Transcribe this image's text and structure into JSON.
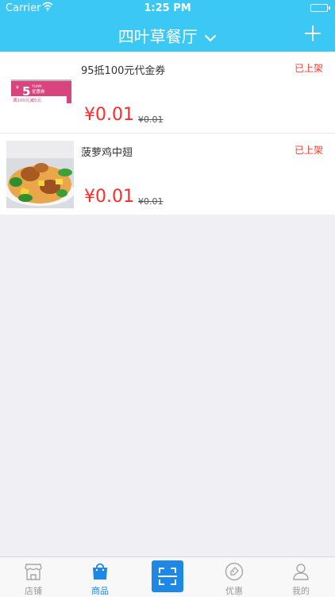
{
  "status_bar": {
    "carrier": "Carrier",
    "time": "1:25 PM"
  },
  "nav": {
    "title": "四叶草餐厅"
  },
  "products": [
    {
      "name": "95抵100元代金券",
      "status": "已上架",
      "price": "¥0.01",
      "original_price": "¥0.01",
      "coupon": {
        "amount": "5",
        "unit": "YUAN",
        "type": "优惠券",
        "rule": "满100元减5元",
        "symbol": "¥"
      }
    },
    {
      "name": "菠萝鸡中翅",
      "status": "已上架",
      "price": "¥0.01",
      "original_price": "¥0.01"
    }
  ],
  "tabbar": {
    "tabs": [
      {
        "label": "店铺",
        "icon": "store-icon",
        "active": false
      },
      {
        "label": "商品",
        "icon": "shopping-bag-icon",
        "active": true
      },
      {
        "label": "",
        "icon": "scan-icon",
        "active": false
      },
      {
        "label": "优惠",
        "icon": "tag-icon",
        "active": false
      },
      {
        "label": "我的",
        "icon": "user-icon",
        "active": false
      }
    ]
  },
  "colors": {
    "header": "#3cc8f5",
    "price": "#ff2b2b",
    "status": "#ff3b30",
    "active_tab": "#1e88e5",
    "coupon": "#d8457e"
  }
}
